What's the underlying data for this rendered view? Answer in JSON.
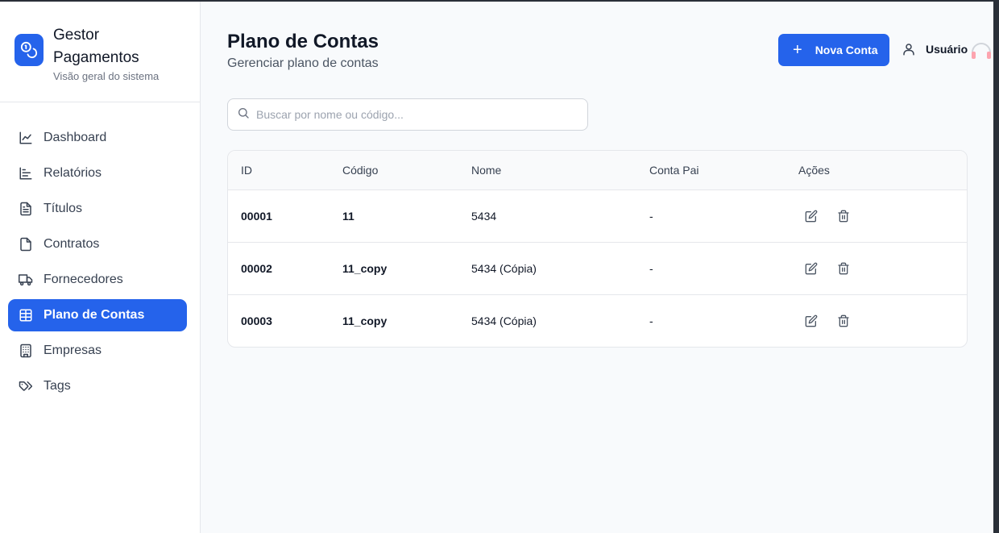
{
  "brand": {
    "title": "Gestor Pagamentos",
    "subtitle": "Visão geral do sistema",
    "logo_icon": "coins-icon",
    "accent": "#2563eb"
  },
  "sidebar": {
    "items": [
      {
        "label": "Dashboard",
        "icon": "chart-line-icon",
        "active": false
      },
      {
        "label": "Relatórios",
        "icon": "chart-bar-icon",
        "active": false
      },
      {
        "label": "Títulos",
        "icon": "file-text-icon",
        "active": false
      },
      {
        "label": "Contratos",
        "icon": "file-icon",
        "active": false
      },
      {
        "label": "Fornecedores",
        "icon": "truck-icon",
        "active": false
      },
      {
        "label": "Plano de Contas",
        "icon": "table-icon",
        "active": true
      },
      {
        "label": "Empresas",
        "icon": "building-icon",
        "active": false
      },
      {
        "label": "Tags",
        "icon": "tags-icon",
        "active": false
      }
    ]
  },
  "header": {
    "title": "Plano de Contas",
    "subtitle": "Gerenciar plano de contas",
    "new_button_label": "Nova Conta",
    "user_label": "Usuário"
  },
  "search": {
    "placeholder": "Buscar por nome ou código...",
    "value": ""
  },
  "table": {
    "columns": [
      "ID",
      "Código",
      "Nome",
      "Conta Pai",
      "Ações"
    ],
    "rows": [
      {
        "id": "00001",
        "codigo": "11",
        "nome": "5434",
        "conta_pai": "-"
      },
      {
        "id": "00002",
        "codigo": "11_copy",
        "nome": "5434 (Cópia)",
        "conta_pai": "-"
      },
      {
        "id": "00003",
        "codigo": "11_copy",
        "nome": "5434 (Cópia)",
        "conta_pai": "-"
      }
    ]
  }
}
